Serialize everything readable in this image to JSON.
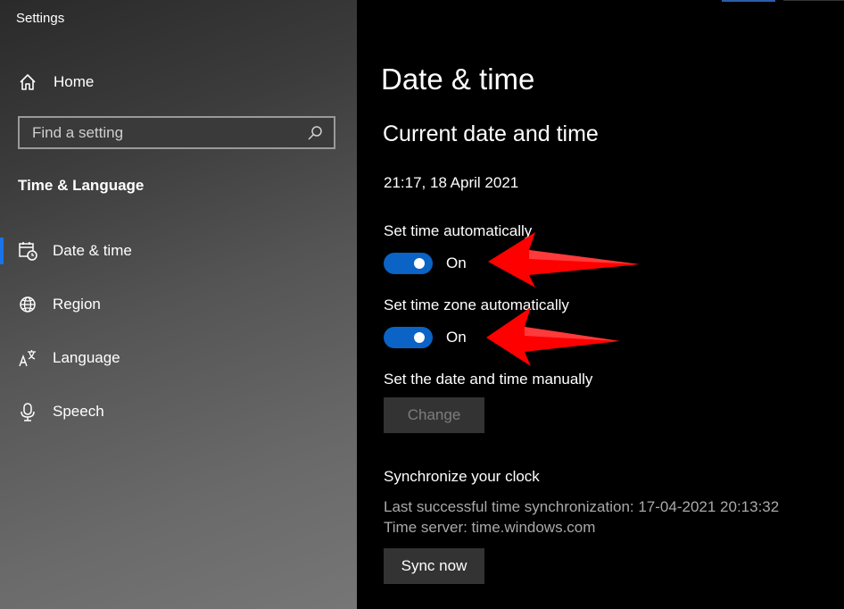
{
  "app": {
    "title": "Settings"
  },
  "sidebar": {
    "home_label": "Home",
    "search": {
      "placeholder": "Find a setting",
      "value": ""
    },
    "section_label": "Time & Language",
    "items": [
      {
        "label": "Date & time",
        "icon": "calendar-clock-icon",
        "active": true
      },
      {
        "label": "Region",
        "icon": "globe-icon",
        "active": false
      },
      {
        "label": "Language",
        "icon": "language-icon",
        "active": false
      },
      {
        "label": "Speech",
        "icon": "microphone-icon",
        "active": false
      }
    ]
  },
  "main": {
    "page_title": "Date & time",
    "section_title": "Current date and time",
    "current_datetime": "21:17, 18 April 2021",
    "set_time_auto": {
      "label": "Set time automatically",
      "state": "On"
    },
    "set_timezone_auto": {
      "label": "Set time zone automatically",
      "state": "On"
    },
    "manual": {
      "label": "Set the date and time manually",
      "button": "Change"
    },
    "sync": {
      "title": "Synchronize your clock",
      "last_sync": "Last successful time synchronization: 17-04-2021 20:13:32",
      "server": "Time server: time.windows.com",
      "button": "Sync now"
    }
  },
  "colors": {
    "accent": "#0a63c5",
    "annotation_arrow": "#ff0000",
    "sidebar_active_marker": "#1a73e8"
  }
}
